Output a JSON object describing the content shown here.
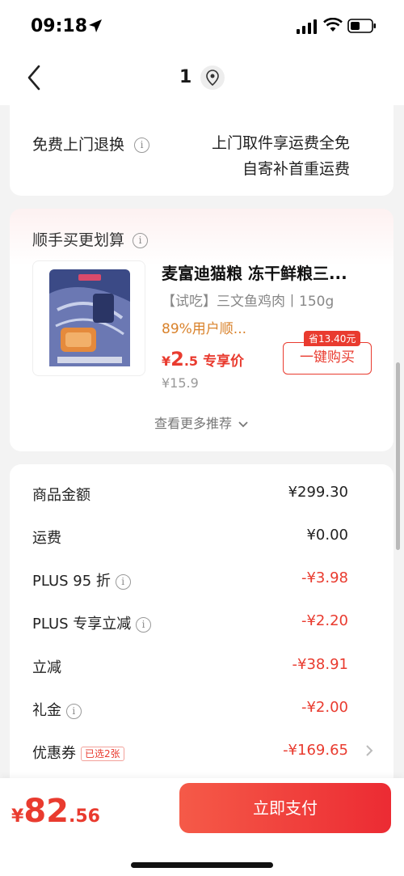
{
  "status": {
    "time": "09:18"
  },
  "nav": {
    "title": "1"
  },
  "return_card": {
    "label": "免费上门退换",
    "info_line1": "上门取件享运费全免",
    "info_line2": "自寄补首重运费"
  },
  "recommend": {
    "title": "顺手买更划算",
    "product": {
      "name": "麦富迪猫粮 冻干鲜粮三...",
      "spec": "【试吃】三文鱼鸡肉丨150g",
      "rating": "89%用户顺...",
      "price_symbol": "¥",
      "price_int": "2",
      "price_dec": ".5",
      "price_tag": "专享价",
      "orig_price": "¥15.9",
      "save_tag": "省13.40元",
      "buy_label": "一键购买"
    },
    "more_label": "查看更多推荐"
  },
  "summary": {
    "rows": [
      {
        "label": "商品金额",
        "value": "¥299.30",
        "info": false
      },
      {
        "label": "运费",
        "value": "¥0.00",
        "info": false
      },
      {
        "label": "PLUS 95 折",
        "value": "-¥3.98",
        "info": true
      },
      {
        "label": "PLUS 专享立减",
        "value": "-¥2.20",
        "info": true
      },
      {
        "label": "立减",
        "value": "-¥38.91",
        "info": false
      },
      {
        "label": "礼金",
        "value": "-¥2.00",
        "info": true
      },
      {
        "label": "优惠券",
        "value": "-¥169.65",
        "chip": "已选2张"
      }
    ]
  },
  "bottom": {
    "total_symbol": "¥",
    "total_int": "82",
    "total_dec": ".56",
    "pay_label": "立即支付"
  },
  "colors": {
    "accent": "#e93b2f",
    "rating": "#d9822b"
  }
}
